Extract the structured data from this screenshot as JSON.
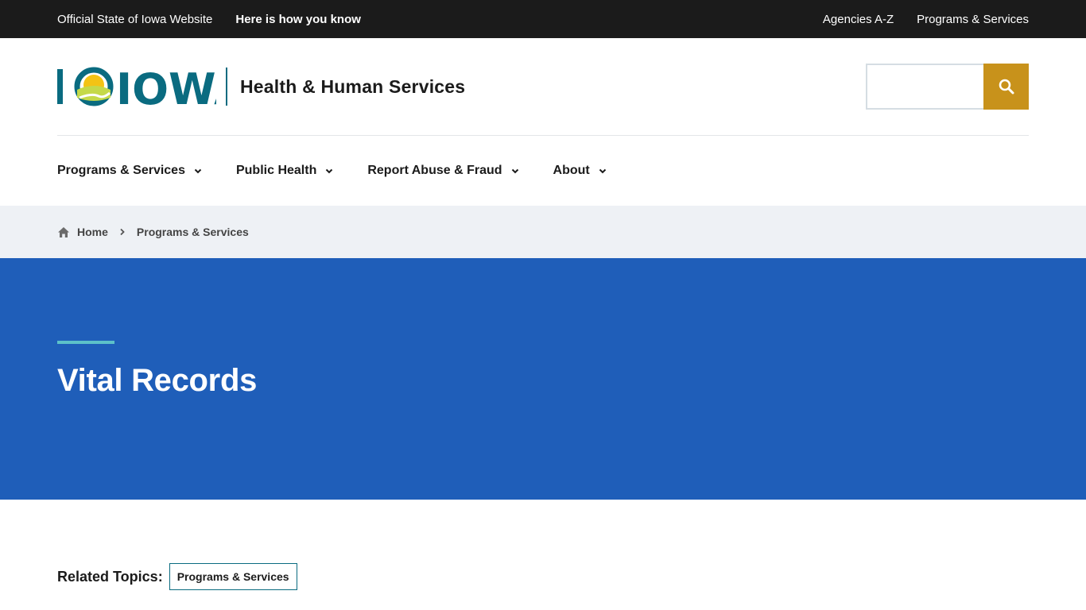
{
  "topbar": {
    "official": "Official State of Iowa Website",
    "how_you_know": "Here is how you know",
    "links": [
      "Agencies A-Z",
      "Programs & Services"
    ]
  },
  "header": {
    "logo_text": "IOWA",
    "agency_name": "Health & Human Services",
    "search": {
      "placeholder": "",
      "value": "",
      "icon": "search-icon"
    }
  },
  "nav": {
    "items": [
      {
        "label": "Programs & Services",
        "icon": "chevron-down-icon"
      },
      {
        "label": "Public Health",
        "icon": "chevron-down-icon"
      },
      {
        "label": "Report Abuse & Fraud",
        "icon": "chevron-down-icon"
      },
      {
        "label": "About",
        "icon": "chevron-down-icon"
      }
    ]
  },
  "breadcrumb": {
    "home": "Home",
    "current": "Programs & Services"
  },
  "hero": {
    "title": "Vital Records"
  },
  "related": {
    "label": "Related Topics:",
    "tags": [
      "Programs & Services"
    ]
  },
  "colors": {
    "topbar": "#1b1b1b",
    "brand_teal": "#0a6b80",
    "search_button": "#c8921b",
    "hero_blue": "#1f5eb9",
    "hero_accent": "#5cc1c9",
    "breadcrumb_bg": "#eef1f5"
  }
}
